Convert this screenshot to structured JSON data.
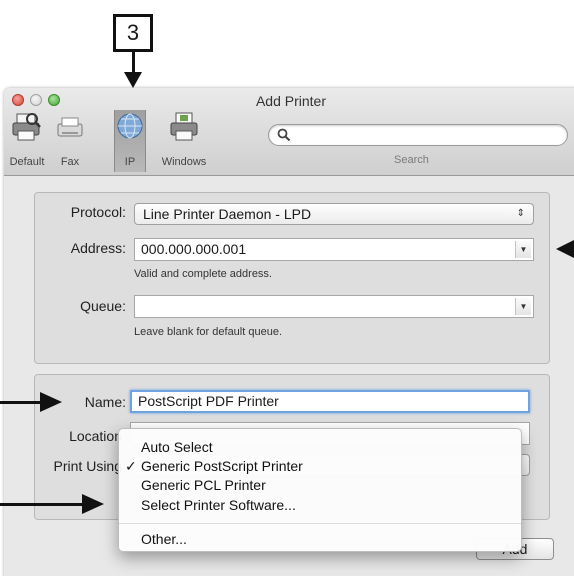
{
  "callout": {
    "number": "3"
  },
  "window": {
    "title": "Add Printer"
  },
  "toolbar": {
    "items": [
      {
        "label": "Default",
        "icon": "printer-default-icon"
      },
      {
        "label": "Fax",
        "icon": "fax-icon"
      },
      {
        "label": "IP",
        "icon": "globe-icon",
        "selected": true
      },
      {
        "label": "Windows",
        "icon": "windows-printer-icon"
      }
    ],
    "search_label": "Search",
    "search_value": ""
  },
  "form": {
    "protocol_label": "Protocol:",
    "protocol_value": "Line Printer Daemon - LPD",
    "address_label": "Address:",
    "address_value": "000.000.000.001",
    "address_hint": "Valid and complete address.",
    "queue_label": "Queue:",
    "queue_value": "",
    "queue_hint": "Leave blank for default queue.",
    "name_label": "Name:",
    "name_value": "PostScript PDF Printer",
    "location_label": "Location",
    "location_value": "",
    "print_using_label": "Print Using",
    "add_button": "Add"
  },
  "dropdown": {
    "items": [
      {
        "label": "Auto Select",
        "checked": false
      },
      {
        "label": "Generic PostScript Printer",
        "checked": true
      },
      {
        "label": "Generic PCL Printer",
        "checked": false
      },
      {
        "label": "Select Printer Software...",
        "checked": false
      }
    ],
    "other_label": "Other...",
    "check_glyph": "✓"
  },
  "colors": {
    "window_bg": "#e8e8e8",
    "focus_ring": "#6fa3e0",
    "close": "#d7473a",
    "zoom": "#47a238"
  }
}
